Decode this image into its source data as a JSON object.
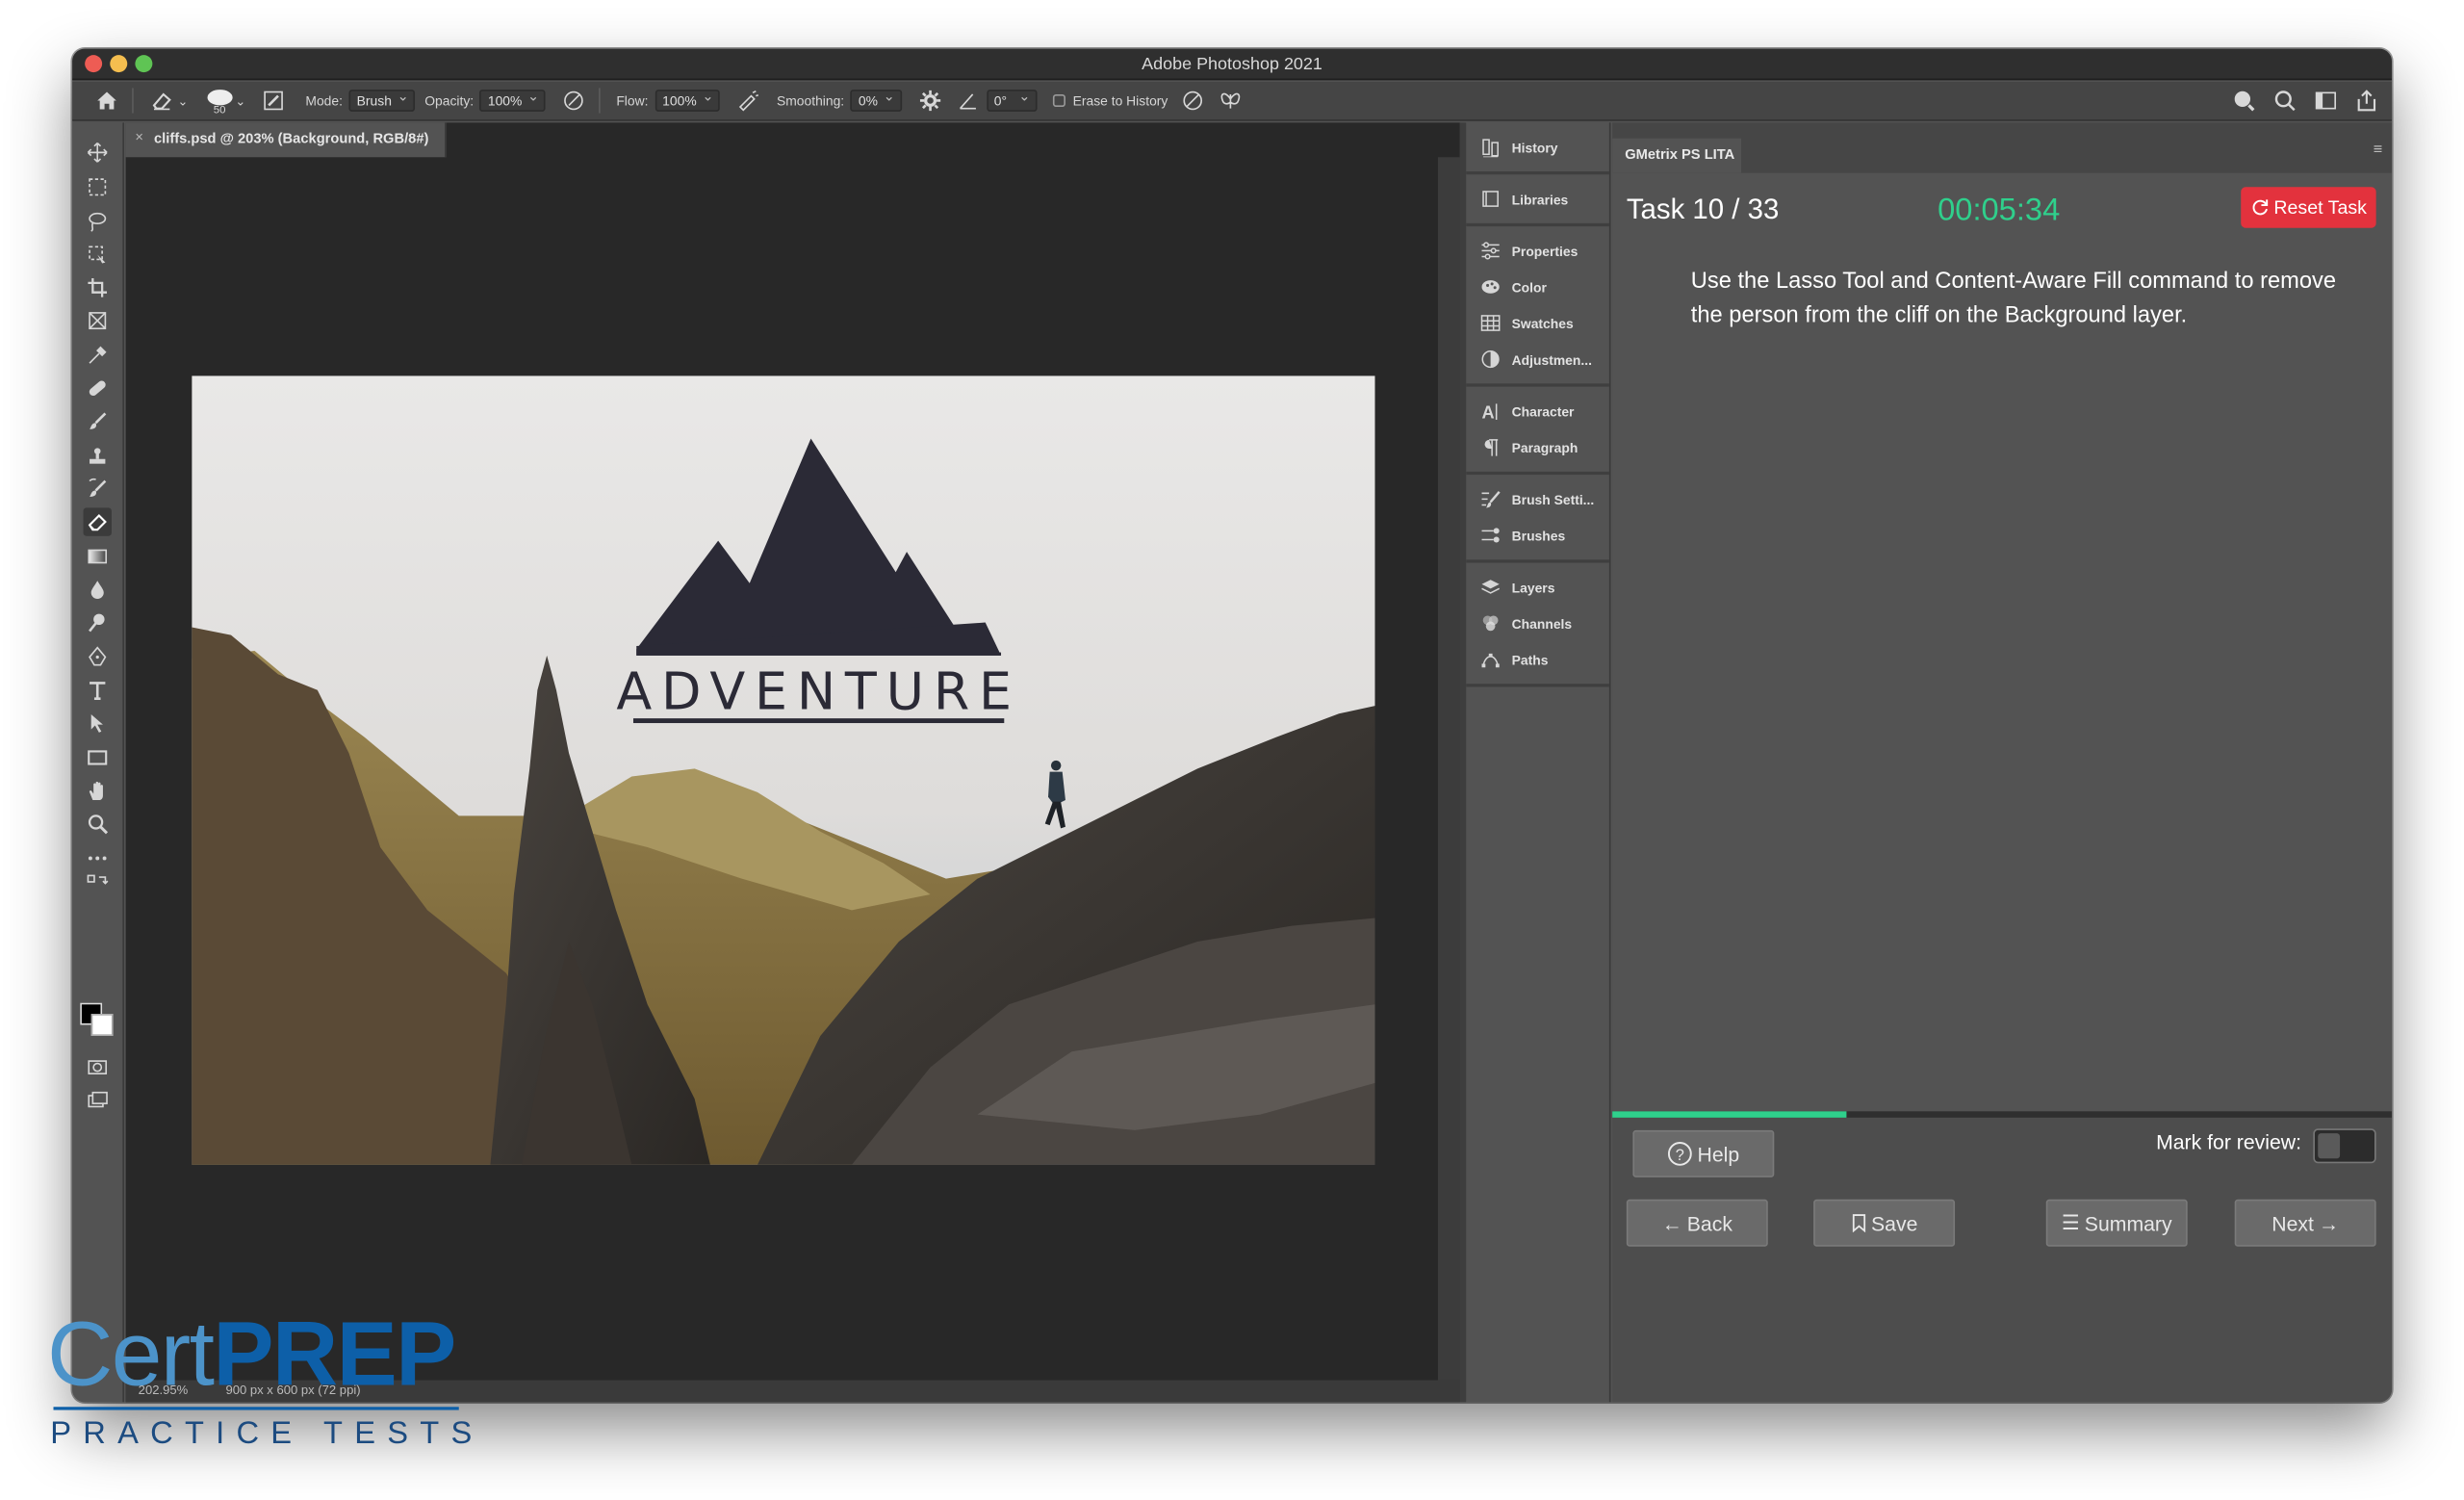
{
  "window": {
    "title": "Adobe Photoshop 2021"
  },
  "options_bar": {
    "brush_size": "50",
    "mode_label": "Mode:",
    "mode_value": "Brush",
    "opacity_label": "Opacity:",
    "opacity_value": "100%",
    "flow_label": "Flow:",
    "flow_value": "100%",
    "smoothing_label": "Smoothing:",
    "smoothing_value": "0%",
    "angle_value": "0°",
    "erase_to_history": "Erase to History"
  },
  "document": {
    "tab_title": "cliffs.psd @ 203% (Background, RGB/8#)",
    "status_zoom": "202.95%",
    "status_size": "900 px x 600 px (72 ppi)",
    "image_text": "ADVENTURE"
  },
  "panels": {
    "groups": [
      [
        {
          "label": "History",
          "icon": "history-icon"
        }
      ],
      [
        {
          "label": "Libraries",
          "icon": "libraries-icon"
        }
      ],
      [
        {
          "label": "Properties",
          "icon": "properties-icon"
        },
        {
          "label": "Color",
          "icon": "color-icon"
        },
        {
          "label": "Swatches",
          "icon": "swatches-icon"
        },
        {
          "label": "Adjustmen...",
          "icon": "adjustments-icon"
        }
      ],
      [
        {
          "label": "Character",
          "icon": "character-icon"
        },
        {
          "label": "Paragraph",
          "icon": "paragraph-icon"
        }
      ],
      [
        {
          "label": "Brush Setti...",
          "icon": "brush-settings-icon"
        },
        {
          "label": "Brushes",
          "icon": "brushes-icon"
        }
      ],
      [
        {
          "label": "Layers",
          "icon": "layers-icon"
        },
        {
          "label": "Channels",
          "icon": "channels-icon"
        },
        {
          "label": "Paths",
          "icon": "paths-icon"
        }
      ]
    ]
  },
  "gmetrix": {
    "tab_label": "GMetrix PS LITA",
    "task": "Task 10 / 33",
    "timer": "00:05:34",
    "reset_label": "Reset Task",
    "instructions": "Use the Lasso Tool and Content-Aware Fill command to remove the person from the cliff on the Background layer.",
    "progress": 0.3,
    "help_label": "Help",
    "mark_review_label": "Mark for review:",
    "mark_review_on": false,
    "back_label": "Back",
    "save_label": "Save",
    "summary_label": "Summary",
    "next_label": "Next"
  },
  "watermark": {
    "cert": "Cert",
    "prep": "PREP",
    "subtitle": "PRACTICE TESTS"
  },
  "colors": {
    "accent_green": "#2fd08c",
    "reset_red": "#e3323d",
    "logo_blue": "#0d5fa8"
  }
}
